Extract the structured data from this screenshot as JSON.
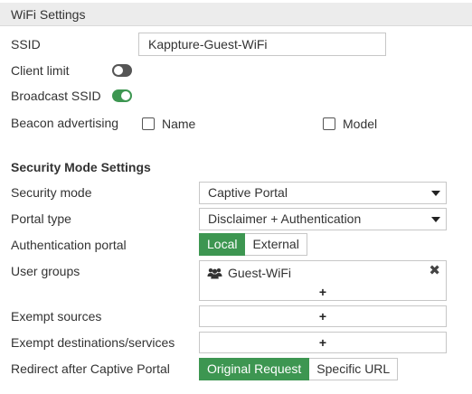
{
  "wifi_settings": {
    "header": "WiFi Settings",
    "ssid_label": "SSID",
    "ssid_value": "Kappture-Guest-WiFi",
    "client_limit_label": "Client limit",
    "client_limit_enabled": false,
    "broadcast_ssid_label": "Broadcast SSID",
    "broadcast_ssid_enabled": true,
    "beacon_label": "Beacon advertising",
    "beacon_name_label": "Name",
    "beacon_name_checked": false,
    "beacon_model_label": "Model",
    "beacon_model_checked": false
  },
  "security": {
    "title": "Security Mode Settings",
    "mode_label": "Security mode",
    "mode_value": "Captive Portal",
    "portal_type_label": "Portal type",
    "portal_type_value": "Disclaimer + Authentication",
    "auth_portal_label": "Authentication portal",
    "auth_portal_options": [
      "Local",
      "External"
    ],
    "auth_portal_selected": "Local",
    "user_groups_label": "User groups",
    "user_groups": [
      "Guest-WiFi"
    ],
    "add_symbol": "+",
    "remove_symbol": "✖",
    "exempt_sources_label": "Exempt sources",
    "exempt_dest_label": "Exempt destinations/services",
    "redirect_label": "Redirect after Captive Portal",
    "redirect_options": [
      "Original Request",
      "Specific URL"
    ],
    "redirect_selected": "Original Request"
  },
  "colors": {
    "accent_green": "#3d9651",
    "toggle_off": "#555555",
    "header_bg": "#ececec"
  },
  "icons": {
    "user_group": "users-icon",
    "remove": "close-icon",
    "dropdown": "caret-down-icon"
  }
}
